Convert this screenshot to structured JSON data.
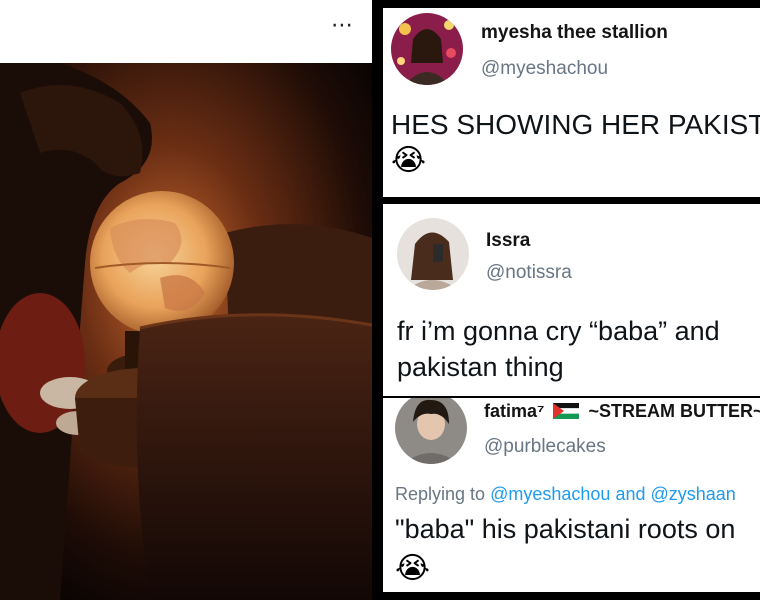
{
  "post": {
    "more_icon": "⋯"
  },
  "tweets": [
    {
      "name": "myesha thee stallion",
      "handle": "@myeshachou",
      "text": "HES SHOWING HER PAKISTAN",
      "emoji": "😭"
    },
    {
      "name": "Issra",
      "handle": "@notissra",
      "text_line1": "fr i’m gonna cry “baba” and",
      "text_line2": "pakistan thing"
    },
    {
      "name_prefix": "fatima⁷",
      "name_suffix": "~STREAM BUTTER~",
      "handle": "@purblecakes",
      "reply_prefix": "Replying to",
      "reply_mention1": "@myeshachou",
      "reply_and": "and",
      "reply_mention2": "@zyshaan",
      "text": "\"baba\" his pakistani roots on",
      "emoji": "😭"
    }
  ],
  "colors": {
    "handle": "#687684",
    "mention": "#1d9bf0",
    "background": "#000000"
  }
}
